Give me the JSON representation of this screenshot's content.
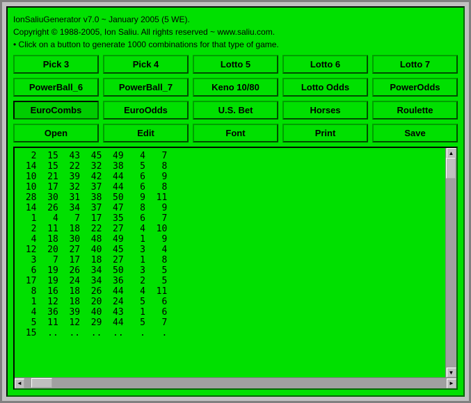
{
  "header": {
    "line1": "IonSaliuGenerator v7.0 ~ January 2005 (5 WE).",
    "line2": "Copyright © 1988-2005, Ion Saliu. All rights reserved ~ www.saliu.com.",
    "line3": "• Click on a button to generate 1000 combinations for that type of game."
  },
  "rows": [
    {
      "cols": [
        "Pick 3",
        "Pick 4",
        "Lotto 5",
        "Lotto 6",
        "Lotto 7"
      ]
    },
    {
      "cols": [
        "PowerBall_6",
        "PowerBall_7",
        "Keno 10/80",
        "Lotto Odds",
        "PowerOdds"
      ]
    },
    {
      "cols": [
        "EuroCombs",
        "EuroOdds",
        "U.S. Bet",
        "Horses",
        "Roulette"
      ]
    },
    {
      "cols": [
        "Open",
        "Edit",
        "Font",
        "Print",
        "Save"
      ]
    }
  ],
  "selected_button": "EuroCombs",
  "output_lines": [
    "  2  15  43  45  49   4   7",
    " 14  15  22  32  38   5   8",
    " 10  21  39  42  44   6   9",
    " 10  17  32  37  44   6   8",
    " 28  30  31  38  50   9  11",
    " 14  26  34  37  47   8   9",
    "  1   4   7  17  35   6   7",
    "  2  11  18  22  27   4  10",
    "  4  18  30  48  49   1   9",
    " 12  20  27  40  45   3   4",
    "  3   7  17  18  27   1   8",
    "  6  19  26  34  50   3   5",
    " 17  19  24  34  36   2   5",
    "  8  16  18  26  44   4  11",
    "  1  12  18  20  24   5   6",
    "  4  36  39  40  43   1   6",
    "  5  11  12  29  44   5   7",
    " 15  ..  ..  ..  ..   .   ."
  ]
}
